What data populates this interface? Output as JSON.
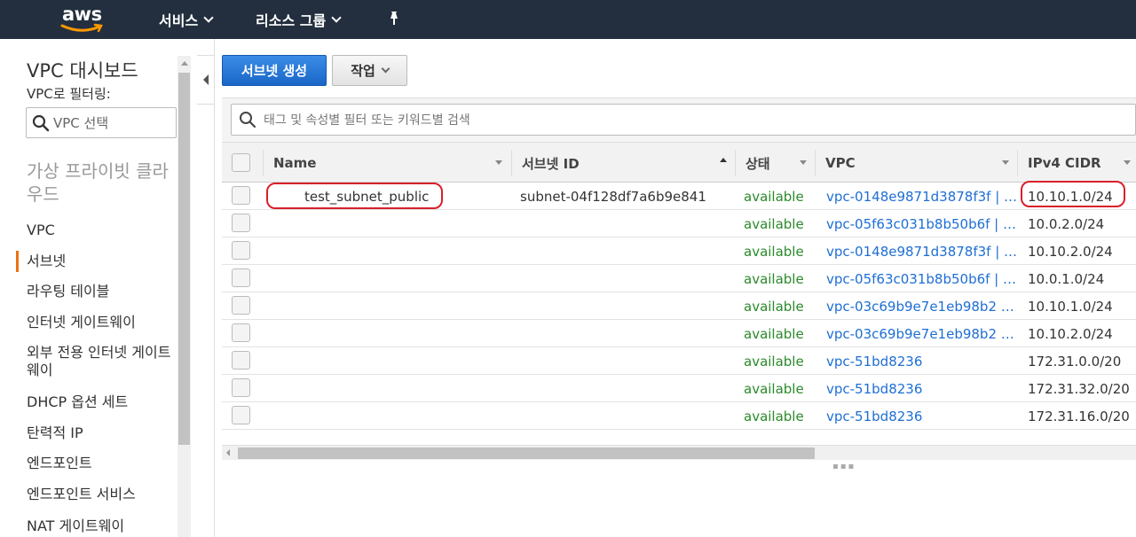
{
  "nav": {
    "logo": "aws",
    "services": "서비스",
    "resource_groups": "리소스 그룹"
  },
  "sidebar": {
    "title": "VPC 대시보드",
    "filter_label": "VPC로 필터링:",
    "search_placeholder": "VPC 선택",
    "section": "가상 프라이빗 클라우드",
    "items": [
      {
        "label": "VPC"
      },
      {
        "label": "서브넷",
        "active": true
      },
      {
        "label": "라우팅 테이블"
      },
      {
        "label": "인터넷 게이트웨이"
      },
      {
        "label": "외부 전용 인터넷 게이트웨이"
      },
      {
        "label": "DHCP 옵션 세트"
      },
      {
        "label": "탄력적 IP"
      },
      {
        "label": "엔드포인트"
      },
      {
        "label": "엔드포인트 서비스"
      },
      {
        "label": "NAT 게이트웨이"
      }
    ]
  },
  "toolbar": {
    "create_label": "서브넷 생성",
    "actions_label": "작업"
  },
  "search": {
    "placeholder": "태그 및 속성별 필터 또는 키워드별 검색"
  },
  "table": {
    "columns": [
      "Name",
      "서브넷 ID",
      "상태",
      "VPC",
      "IPv4 CIDR"
    ],
    "rows": [
      {
        "name": "test_subnet_public",
        "id": "subnet-04f128df7a6b9e841",
        "state": "available",
        "vpc": "vpc-0148e9871d3878f3f | …",
        "cidr": "10.10.1.0/24"
      },
      {
        "name": "",
        "id": "",
        "state": "available",
        "vpc": "vpc-05f63c031b8b50b6f | …",
        "cidr": "10.0.2.0/24"
      },
      {
        "name": "",
        "id": "",
        "state": "available",
        "vpc": "vpc-0148e9871d3878f3f | …",
        "cidr": "10.10.2.0/24"
      },
      {
        "name": "",
        "id": "",
        "state": "available",
        "vpc": "vpc-05f63c031b8b50b6f | …",
        "cidr": "10.0.1.0/24"
      },
      {
        "name": "",
        "id": "",
        "state": "available",
        "vpc": "vpc-03c69b9e7e1eb98b2 …",
        "cidr": "10.10.1.0/24"
      },
      {
        "name": "",
        "id": "",
        "state": "available",
        "vpc": "vpc-03c69b9e7e1eb98b2 …",
        "cidr": "10.10.2.0/24"
      },
      {
        "name": "",
        "id": "",
        "state": "available",
        "vpc": "vpc-51bd8236",
        "cidr": "172.31.0.0/20"
      },
      {
        "name": "",
        "id": "",
        "state": "available",
        "vpc": "vpc-51bd8236",
        "cidr": "172.31.32.0/20"
      },
      {
        "name": "",
        "id": "",
        "state": "available",
        "vpc": "vpc-51bd8236",
        "cidr": "172.31.16.0/20"
      }
    ]
  },
  "colors": {
    "nav_bg": "#232f3e",
    "primary": "#1e6ed4",
    "available": "#2a8a2a",
    "link": "#1e6ed4",
    "active_marker": "#ec7211",
    "annotation": "#d9202a"
  }
}
